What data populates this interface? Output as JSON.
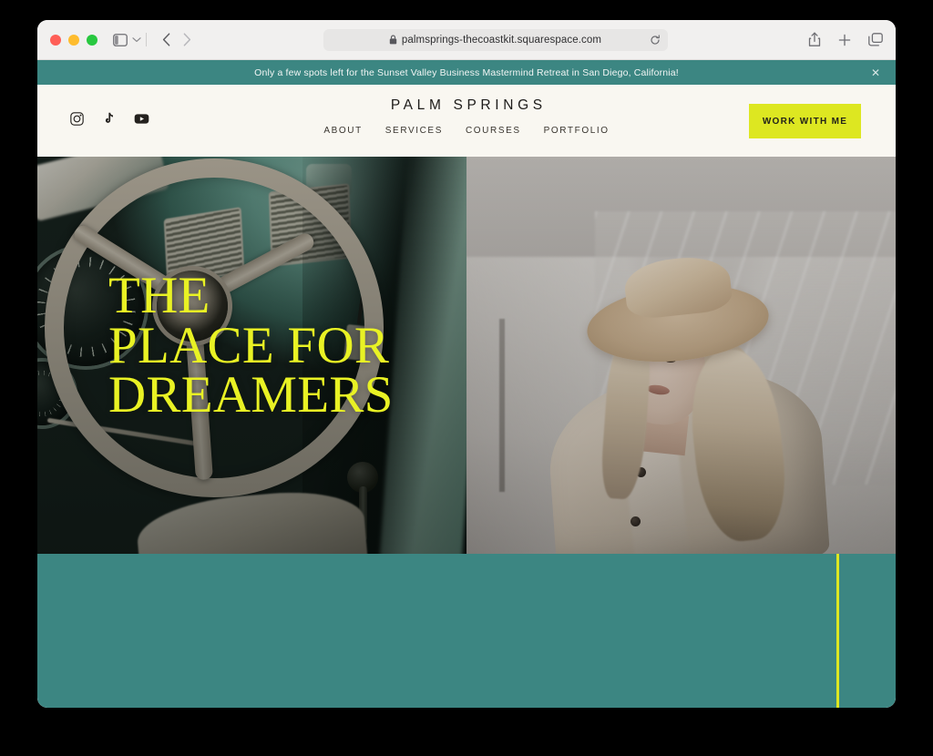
{
  "browser": {
    "traffic_lights": [
      "close",
      "minimize",
      "maximize"
    ],
    "sidebar_toggle_icon": "sidebar-icon",
    "sidebar_chevron_icon": "chevron-down-icon",
    "back_icon": "chevron-left-icon",
    "forward_icon": "chevron-right-icon",
    "url": "palmsprings-thecoastkit.squarespace.com",
    "lock_icon": "lock-icon",
    "reload_icon": "reload-icon",
    "share_icon": "share-icon",
    "new_tab_icon": "plus-icon",
    "tab_overview_icon": "tab-overview-icon",
    "toolbar_bg": "#f1f0ef"
  },
  "announcement": {
    "text": "Only a few spots left for the Sunset Valley Business Mastermind Retreat in San Diego, California!",
    "close_icon": "close-icon",
    "background": "#3c8682",
    "text_color": "#f2f6f5"
  },
  "header": {
    "brand": "PALM SPRINGS",
    "background": "#f9f7f1",
    "social": [
      {
        "name": "instagram-icon",
        "label": "Instagram"
      },
      {
        "name": "tiktok-icon",
        "label": "TikTok"
      },
      {
        "name": "youtube-icon",
        "label": "YouTube"
      }
    ],
    "nav": [
      {
        "label": "ABOUT"
      },
      {
        "label": "SERVICES"
      },
      {
        "label": "COURSES"
      },
      {
        "label": "PORTFOLIO"
      }
    ],
    "cta": {
      "label": "WORK WITH ME",
      "background": "#dde721",
      "text_color": "#23231a"
    }
  },
  "hero": {
    "headline": "THE\nPLACE FOR\nDREAMERS",
    "headline_color": "#e9f224",
    "left_image_alt": "Vintage mint-green car interior with large cream steering wheel, gauges and dashboard vents",
    "right_image_alt": "Blonde woman in a wide-brim tan hat and beige trench coat looking over her shoulder"
  },
  "teal_section": {
    "background": "#3c8682",
    "accent_rule_color": "#dde721"
  }
}
